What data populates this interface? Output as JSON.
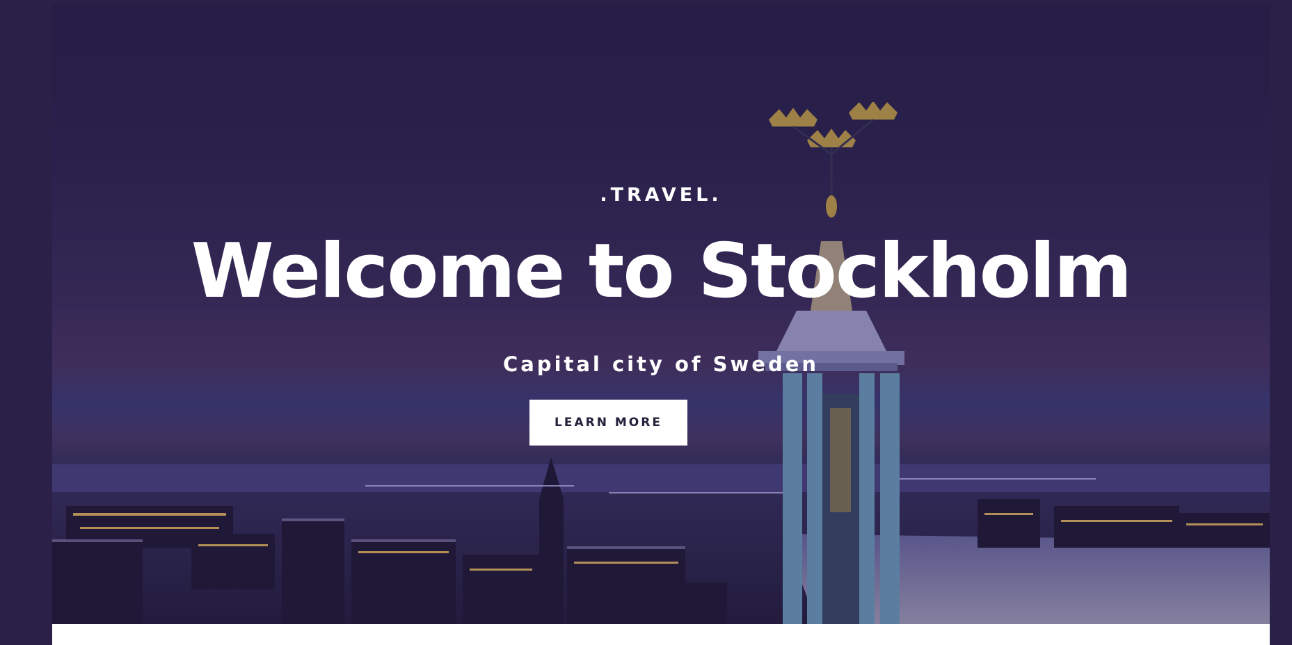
{
  "hero": {
    "eyebrow": ".TRAVEL.",
    "title": "Welcome to Stockholm",
    "subtitle": "Capital city of Sweden",
    "cta_label": "LEARN MORE"
  },
  "colors": {
    "page_background": "#2a2048",
    "text": "#ffffff",
    "button_background": "#ffffff",
    "button_text": "#23203a"
  }
}
